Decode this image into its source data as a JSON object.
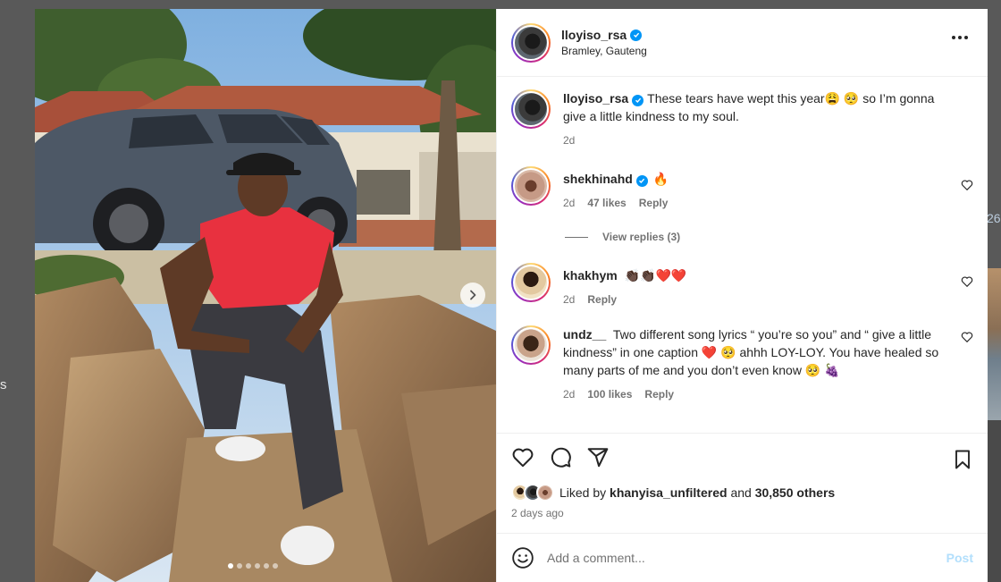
{
  "backdrop": {
    "left_fragment": "s",
    "right_fragment": "26"
  },
  "post": {
    "username": "lloyiso_rsa",
    "location": "Bramley, Gauteng",
    "caption": "These tears have wept this year😩 🥺  so I’m gonna give a little kindness to my soul.",
    "caption_time": "2d",
    "carousel": {
      "slides": 6,
      "active_index": 0
    }
  },
  "comments": [
    {
      "username": "shekhinahd",
      "verified": true,
      "text": "🔥",
      "time": "2d",
      "likes": "47 likes",
      "reply": "Reply"
    },
    {
      "username": "khakhym",
      "verified": false,
      "text": "👏🏿👏🏿❤️❤️",
      "time": "2d",
      "likes": "",
      "reply": "Reply"
    },
    {
      "username": "undz__",
      "verified": false,
      "text": "Two different song lyrics “ you’re so you” and “ give a little kindness” in one caption ❤️ 🥺 ahhh LOY-LOY. You have healed so many parts of me and you don’t even know 🥺 🍇",
      "time": "2d",
      "likes": "100 likes",
      "reply": "Reply"
    }
  ],
  "view_replies": "View replies (3)",
  "liked_by": {
    "prefix": "Liked by",
    "user": "khanyisa_unfiltered",
    "connector": "and",
    "others": "30,850 others"
  },
  "time_ago": "2 days ago",
  "add_comment": {
    "placeholder": "Add a comment...",
    "post_label": "Post"
  },
  "colors": {
    "verified": "#0095f6",
    "post_disabled": "#b2dffc",
    "muted": "#737373"
  },
  "icons": [
    "verified-icon",
    "more-icon",
    "heart-icon",
    "comment-icon",
    "share-icon",
    "bookmark-icon",
    "emoji-icon",
    "chevron-right-icon"
  ]
}
